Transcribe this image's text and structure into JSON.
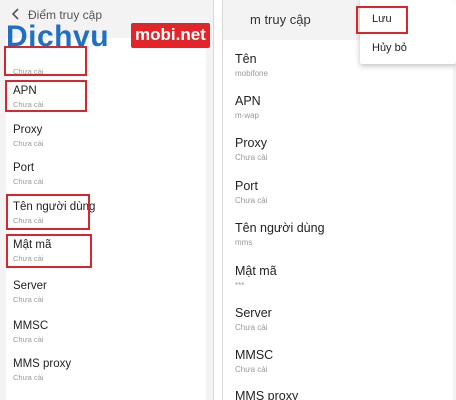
{
  "left": {
    "header_title": "Điểm truy cập",
    "items": [
      {
        "name": "",
        "sub": "Chưa cài"
      },
      {
        "name": "APN",
        "sub": "Chưa cài"
      },
      {
        "name": "Proxy",
        "sub": "Chưa cài"
      },
      {
        "name": "Port",
        "sub": "Chưa cài"
      },
      {
        "name": "Tên người dùng",
        "sub": "Chưa cài"
      },
      {
        "name": "Mật mã",
        "sub": "Chưa cài"
      },
      {
        "name": "Server",
        "sub": "Chưa cài"
      },
      {
        "name": "MMSC",
        "sub": "Chưa cài"
      },
      {
        "name": "MMS proxy",
        "sub": "Chưa cài"
      }
    ]
  },
  "right": {
    "header_title": "m truy cập",
    "items": [
      {
        "name": "Tên",
        "sub": "mobifone"
      },
      {
        "name": "APN",
        "sub": "m-wap"
      },
      {
        "name": "Proxy",
        "sub": "Chưa cài"
      },
      {
        "name": "Port",
        "sub": "Chưa cài"
      },
      {
        "name": "Tên người dùng",
        "sub": "mms"
      },
      {
        "name": "Mật mã",
        "sub": "***"
      },
      {
        "name": "Server",
        "sub": "Chưa cài"
      },
      {
        "name": "MMSC",
        "sub": "Chưa cài"
      },
      {
        "name": "MMS proxy",
        "sub": ""
      }
    ]
  },
  "popup": {
    "save": "Lưu",
    "cancel": "Hủy bỏ"
  },
  "logo": {
    "word": "Dichvu",
    "badge": "mobi.net"
  },
  "colors": {
    "highlight": "#d9262c",
    "brand_blue": "#1f6fc4",
    "brand_red": "#e32429"
  }
}
